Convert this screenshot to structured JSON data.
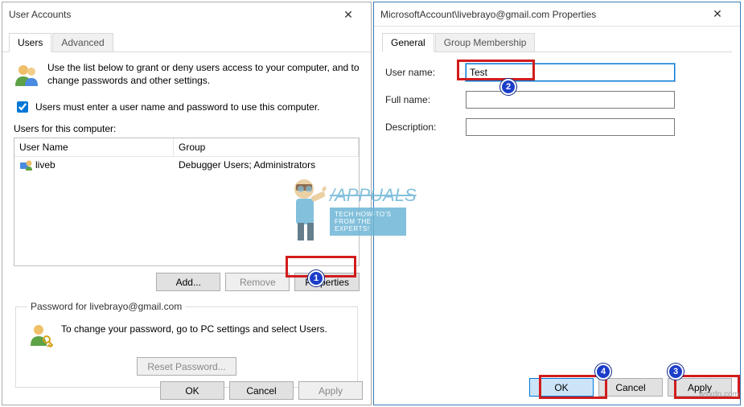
{
  "userAccounts": {
    "title": "User Accounts",
    "tabs": {
      "users": "Users",
      "advanced": "Advanced"
    },
    "intro": "Use the list below to grant or deny users access to your computer, and to change passwords and other settings.",
    "checkboxLabel": "Users must enter a user name and password to use this computer.",
    "listLabel": "Users for this computer:",
    "columns": {
      "userName": "User Name",
      "group": "Group"
    },
    "row": {
      "user": "liveb",
      "group": "Debugger Users; Administrators"
    },
    "buttons": {
      "add": "Add...",
      "remove": "Remove",
      "properties": "Properties"
    },
    "passwordSection": {
      "legend": "Password for livebrayo@gmail.com",
      "text": "To change your password, go to PC settings and select Users.",
      "resetBtn": "Reset Password..."
    },
    "bottomButtons": {
      "ok": "OK",
      "cancel": "Cancel",
      "apply": "Apply"
    }
  },
  "properties": {
    "title": "MicrosoftAccount\\livebrayo@gmail.com Properties",
    "tabs": {
      "general": "General",
      "groupMembership": "Group Membership"
    },
    "fields": {
      "userNameLabel": "User name:",
      "userNameValue": "Test",
      "fullNameLabel": "Full name:",
      "fullNameValue": "",
      "descriptionLabel": "Description:",
      "descriptionValue": ""
    },
    "bottomButtons": {
      "ok": "OK",
      "cancel": "Cancel",
      "apply": "Apply"
    }
  },
  "markers": {
    "1": "1",
    "2": "2",
    "3": "3",
    "4": "4"
  },
  "watermark": {
    "brand": "/APPUALS",
    "tagline": "TECH HOW-TO'S FROM THE EXPERTS!",
    "footer": "wsxdn.com"
  }
}
